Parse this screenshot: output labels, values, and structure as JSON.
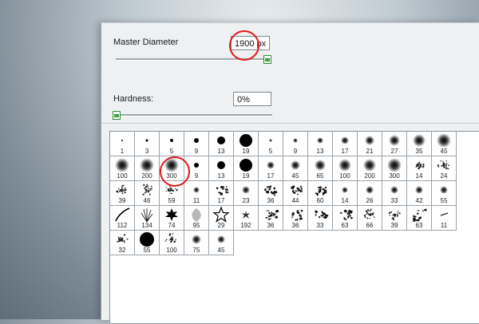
{
  "panel": {
    "master_diameter_label": "Master Diameter",
    "master_diameter_value": "1900 px",
    "master_diameter_fraction": 0.98,
    "hardness_label": "Hardness:",
    "hardness_value": "0%",
    "hardness_fraction": 0.0
  },
  "brushes": [
    {
      "n": "1",
      "t": "hard",
      "s": 1
    },
    {
      "n": "3",
      "t": "hard",
      "s": 1.5
    },
    {
      "n": "5",
      "t": "hard",
      "s": 2
    },
    {
      "n": "9",
      "t": "hard",
      "s": 3
    },
    {
      "n": "13",
      "t": "hard",
      "s": 5
    },
    {
      "n": "19",
      "t": "hard",
      "s": 8
    },
    {
      "n": "5",
      "t": "soft",
      "s": 2
    },
    {
      "n": "9",
      "t": "soft",
      "s": 3
    },
    {
      "n": "13",
      "t": "soft",
      "s": 4
    },
    {
      "n": "17",
      "t": "soft",
      "s": 5
    },
    {
      "n": "21",
      "t": "soft",
      "s": 6
    },
    {
      "n": "27",
      "t": "soft",
      "s": 7
    },
    {
      "n": "35",
      "t": "soft",
      "s": 8
    },
    {
      "n": "45",
      "t": "soft",
      "s": 9
    },
    {
      "n": "100",
      "t": "soft",
      "s": 9
    },
    {
      "n": "200",
      "t": "soft",
      "s": 9
    },
    {
      "n": "300",
      "t": "soft",
      "s": 9
    },
    {
      "n": "9",
      "t": "hard",
      "s": 3
    },
    {
      "n": "13",
      "t": "hard",
      "s": 5
    },
    {
      "n": "19",
      "t": "hard",
      "s": 8
    },
    {
      "n": "17",
      "t": "soft",
      "s": 5
    },
    {
      "n": "45",
      "t": "soft",
      "s": 6
    },
    {
      "n": "65",
      "t": "soft",
      "s": 7
    },
    {
      "n": "100",
      "t": "soft",
      "s": 8
    },
    {
      "n": "200",
      "t": "soft",
      "s": 8
    },
    {
      "n": "300",
      "t": "soft",
      "s": 9
    },
    {
      "n": "14",
      "t": "speckle",
      "s": 6
    },
    {
      "n": "24",
      "t": "speckle",
      "s": 8
    },
    {
      "n": "39",
      "t": "speckle",
      "s": 7
    },
    {
      "n": "46",
      "t": "speckle",
      "s": 8
    },
    {
      "n": "59",
      "t": "speckle",
      "s": 8
    },
    {
      "n": "11",
      "t": "soft",
      "s": 4
    },
    {
      "n": "17",
      "t": "blob",
      "s": 6
    },
    {
      "n": "23",
      "t": "soft",
      "s": 5
    },
    {
      "n": "36",
      "t": "blob",
      "s": 7
    },
    {
      "n": "44",
      "t": "blob",
      "s": 7
    },
    {
      "n": "60",
      "t": "blob",
      "s": 7
    },
    {
      "n": "14",
      "t": "soft",
      "s": 4
    },
    {
      "n": "26",
      "t": "soft",
      "s": 5
    },
    {
      "n": "33",
      "t": "soft",
      "s": 5
    },
    {
      "n": "42",
      "t": "soft",
      "s": 5
    },
    {
      "n": "55",
      "t": "soft",
      "s": 5
    },
    {
      "n": "112",
      "t": "stroke",
      "s": 8
    },
    {
      "n": "134",
      "t": "grass",
      "s": 8
    },
    {
      "n": "74",
      "t": "maple",
      "s": 8
    },
    {
      "n": "95",
      "t": "leaf",
      "s": 8
    },
    {
      "n": "29",
      "t": "star",
      "s": 8
    },
    {
      "n": "192",
      "t": "splat",
      "s": 6
    },
    {
      "n": "36",
      "t": "blob",
      "s": 7
    },
    {
      "n": "36",
      "t": "blob",
      "s": 7
    },
    {
      "n": "33",
      "t": "blob",
      "s": 7
    },
    {
      "n": "63",
      "t": "blob",
      "s": 8
    },
    {
      "n": "66",
      "t": "speckle",
      "s": 8
    },
    {
      "n": "39",
      "t": "speckle",
      "s": 7
    },
    {
      "n": "63",
      "t": "blob",
      "s": 8
    },
    {
      "n": "11",
      "t": "dash",
      "s": 4
    },
    {
      "n": "32",
      "t": "speckle",
      "s": 7
    },
    {
      "n": "55",
      "t": "hard",
      "s": 9
    },
    {
      "n": "100",
      "t": "speckle",
      "s": 8
    },
    {
      "n": "75",
      "t": "soft",
      "s": 6
    },
    {
      "n": "45",
      "t": "soft",
      "s": 5
    }
  ]
}
